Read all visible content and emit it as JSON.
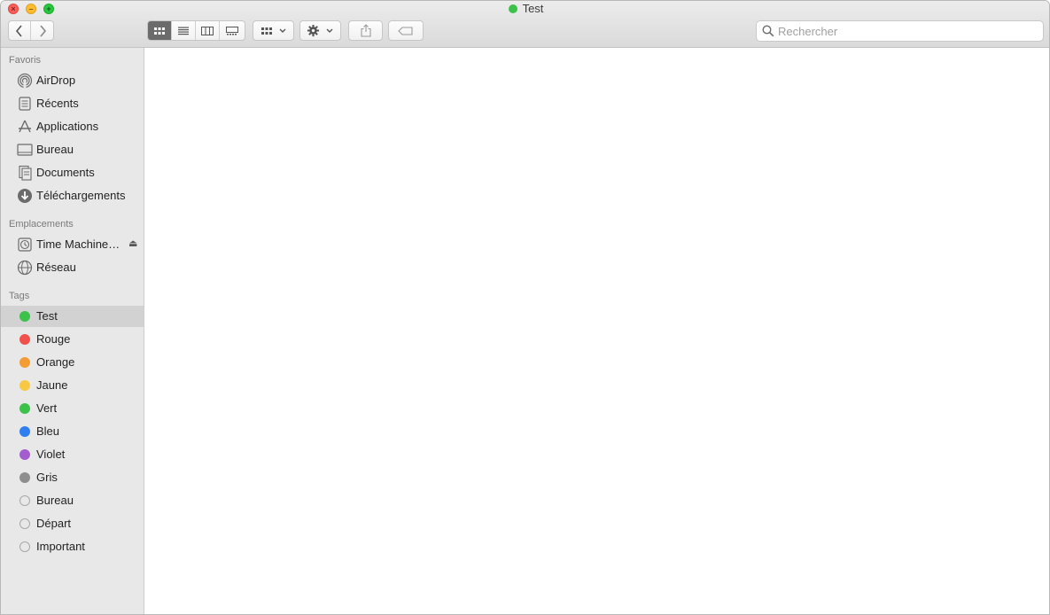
{
  "window": {
    "title": "Test",
    "title_tag_color": "#3cc14a"
  },
  "toolbar": {
    "back_icon": "chevron-left-icon",
    "forward_icon": "chevron-right-icon",
    "views": [
      "icon-view",
      "list-view",
      "column-view",
      "gallery-view"
    ],
    "active_view": "icon-view",
    "group_icon": "grid-icon",
    "action_icon": "gear-icon",
    "share_icon": "share-icon",
    "tag_icon": "tag-icon"
  },
  "search": {
    "placeholder": "Rechercher"
  },
  "sidebar": {
    "favorites_header": "Favoris",
    "favorites": [
      {
        "label": "AirDrop",
        "icon": "airdrop-icon"
      },
      {
        "label": "Récents",
        "icon": "recents-icon"
      },
      {
        "label": "Applications",
        "icon": "applications-icon"
      },
      {
        "label": "Bureau",
        "icon": "desktop-icon"
      },
      {
        "label": "Documents",
        "icon": "documents-icon"
      },
      {
        "label": "Téléchargements",
        "icon": "downloads-icon"
      }
    ],
    "locations_header": "Emplacements",
    "locations": [
      {
        "label": "Time Machine…",
        "icon": "time-machine-icon"
      },
      {
        "label": "Réseau",
        "icon": "network-icon"
      }
    ],
    "tags_header": "Tags",
    "tags": [
      {
        "label": "Test",
        "color": "#3cc14a",
        "selected": true
      },
      {
        "label": "Rouge",
        "color": "#f2504b"
      },
      {
        "label": "Orange",
        "color": "#f39c34"
      },
      {
        "label": "Jaune",
        "color": "#f7c843"
      },
      {
        "label": "Vert",
        "color": "#3cc14a"
      },
      {
        "label": "Bleu",
        "color": "#2f7ff0"
      },
      {
        "label": "Violet",
        "color": "#a35dcf"
      },
      {
        "label": "Gris",
        "color": "#8e8e8e"
      },
      {
        "label": "Bureau",
        "color": ""
      },
      {
        "label": "Départ",
        "color": ""
      },
      {
        "label": "Important",
        "color": ""
      }
    ]
  }
}
